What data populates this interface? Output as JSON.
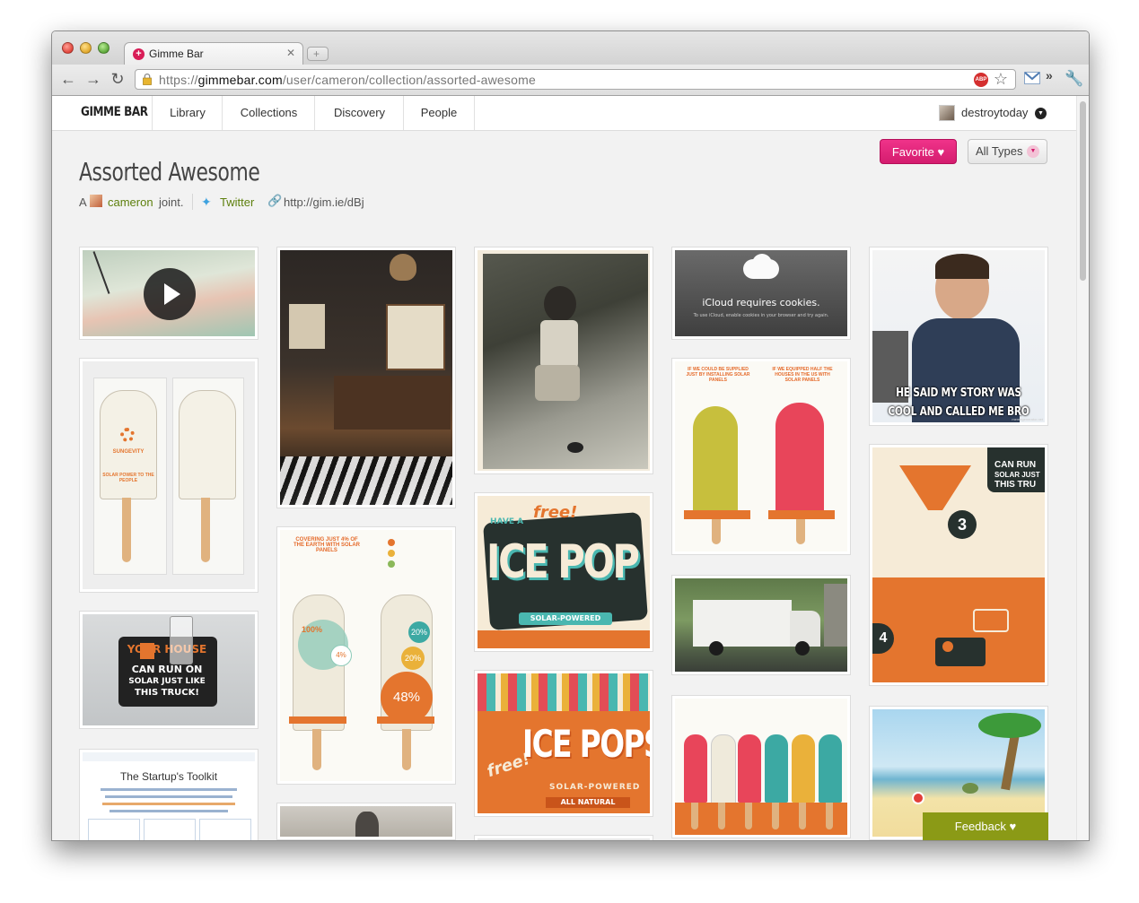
{
  "browser": {
    "tab_title": "Gimme Bar",
    "tab_close": "✕",
    "url_scheme": "https://",
    "url_host": "gimmebar.com",
    "url_path": "/user/cameron/collection/assorted-awesome",
    "abp_label": "ABP"
  },
  "nav": {
    "logo": "GIMME BAR",
    "items": [
      "Library",
      "Collections",
      "Discovery",
      "People"
    ],
    "username": "destroytoday"
  },
  "collection": {
    "title": "Assorted Awesome",
    "byline_prefix": "A",
    "owner": "cameron",
    "byline_suffix": "joint.",
    "twitter_label": "Twitter",
    "short_url": "http://gim.ie/dBj"
  },
  "actions": {
    "favorite_label": "Favorite",
    "types_label": "All Types"
  },
  "assets": {
    "icloud_text": "iCloud requires cookies.",
    "icloud_sub": "To use iCloud, enable cookies in your browser and try again.",
    "meme_line1": "HE SAID MY STORY WAS",
    "meme_line2": "COOL AND CALLED ME BRO",
    "meme_site": "memegenerator.net",
    "sungevity": "SUNGEVITY",
    "solar_power": "SOLAR POWER TO THE PEOPLE",
    "icepop": "ICE POP",
    "icepop_free": "free!",
    "icepop_have": "HAVE A",
    "icepop_solar": "SOLAR-POWERED",
    "icepops": "ICE POPS",
    "icepops_solar": "SOLAR-POWERED",
    "icepops_natural": "ALL NATURAL",
    "truck_your_house": "YOUR HOUSE",
    "truck_can_run": "CAN RUN ON",
    "truck_solar": "SOLAR JUST LIKE",
    "truck_this": "THIS TRUCK!",
    "truck_right_line1": "CAN RUN",
    "truck_right_line2": "SOLAR JUST",
    "truck_right_line3": "THIS TRU",
    "toolkit_title": "The Startup's Toolkit",
    "pct_100": "100%",
    "pct_4": "4%",
    "pct_20a": "20%",
    "pct_20b": "20%",
    "pct_48": "48%",
    "step_3": "3",
    "step_4": "4"
  },
  "colors": {
    "accent_pink": "#d41c6e",
    "accent_green": "#8b9a16",
    "link_green": "#5d7f0c"
  },
  "feedback_label": "Feedback ♥"
}
